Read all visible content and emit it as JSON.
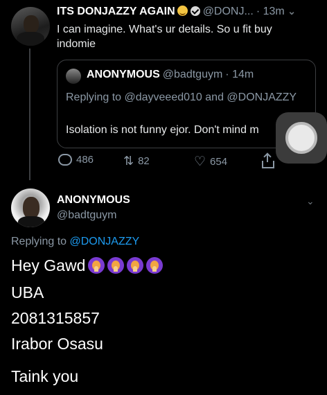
{
  "original_tweet": {
    "display_name": "ITS DONJAZZY AGAIN",
    "handle": "@DONJ...",
    "time": "· 13m",
    "text": "I can imagine. What's ur details. So u fit buy indomie",
    "quoted": {
      "display_name": "ANONYMOUS",
      "handle": "@badtguym",
      "time": "· 14m",
      "replying_to": "Replying to @dayveeed010 and @DONJAZZY",
      "text": "Isolation is not funny ejor. Don't mind m"
    },
    "stats": {
      "replies": "486",
      "retweets": "82",
      "likes": "654"
    }
  },
  "reply_tweet": {
    "display_name": "ANONYMOUS",
    "handle": "@badtguym",
    "replying_prefix": "Replying to",
    "replying_user": "@DONJAZZY",
    "line1": "Hey Gawd",
    "line2": "UBA",
    "line3": "2081315857",
    "line4": "Irabor Osasu",
    "line5": "Taink you"
  },
  "icons": {
    "reply": "reply-icon",
    "retweet": "retweet-icon",
    "like": "heart-icon",
    "share": "share-icon",
    "more": "chevron-down-icon",
    "assistive_touch": "assistive-touch-icon"
  },
  "colors": {
    "background": "#000000",
    "secondary_text": "#8b98a5",
    "link": "#1d9bf0"
  }
}
